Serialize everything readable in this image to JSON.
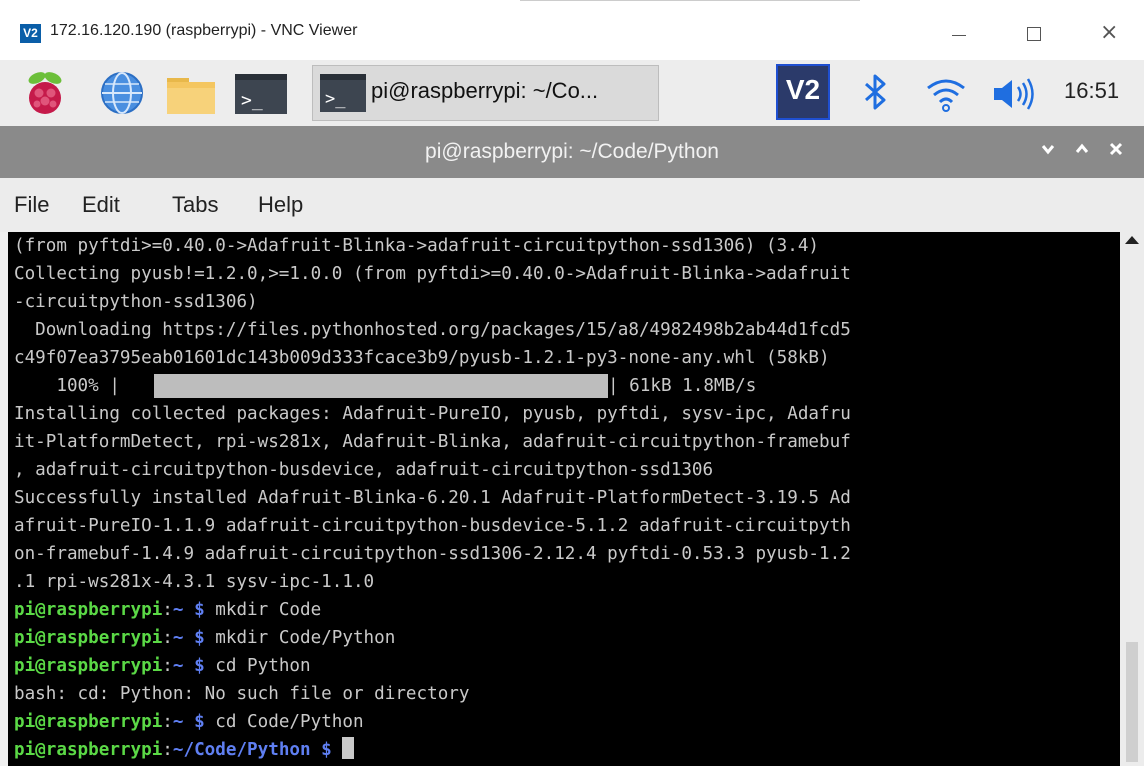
{
  "vnc_window": {
    "logo": "V2",
    "title": "172.16.120.190 (raspberrypi) - VNC Viewer",
    "close_glyph": "×"
  },
  "taskbar": {
    "icons": [
      "raspberry-menu-icon",
      "web-browser-icon",
      "file-manager-icon",
      "terminal-icon"
    ],
    "task_label": "pi@raspberrypi: ~/Co...",
    "vnc_tray_label": "V2",
    "clock": "16:51"
  },
  "terminal_window": {
    "title": "pi@raspberrypi: ~/Code/Python",
    "controls": [
      "v",
      "^",
      "x"
    ]
  },
  "menu": {
    "file": "File",
    "edit": "Edit",
    "tabs": "Tabs",
    "help": "Help"
  },
  "terminal": {
    "output": [
      "(from pyftdi>=0.40.0->Adafruit-Blinka->adafruit-circuitpython-ssd1306) (3.4)",
      "Collecting pyusb!=1.2.0,>=1.0.0 (from pyftdi>=0.40.0->Adafruit-Blinka->adafruit",
      "-circuitpython-ssd1306)",
      "  Downloading https://files.pythonhosted.org/packages/15/a8/4982498b2ab44d1fcd5",
      "c49f07ea3795eab01601dc143b009d333fcace3b9/pyusb-1.2.1-py3-none-any.whl (58kB)"
    ],
    "progress": {
      "percent_label": "    100% |",
      "fraction": 1.0,
      "suffix": "| 61kB 1.8MB/s"
    },
    "output2": [
      "Installing collected packages: Adafruit-PureIO, pyusb, pyftdi, sysv-ipc, Adafru",
      "it-PlatformDetect, rpi-ws281x, Adafruit-Blinka, adafruit-circuitpython-framebuf",
      ", adafruit-circuitpython-busdevice, adafruit-circuitpython-ssd1306",
      "Successfully installed Adafruit-Blinka-6.20.1 Adafruit-PlatformDetect-3.19.5 Ad",
      "afruit-PureIO-1.1.9 adafruit-circuitpython-busdevice-5.1.2 adafruit-circuitpyth",
      "on-framebuf-1.4.9 adafruit-circuitpython-ssd1306-2.12.4 pyftdi-0.53.3 pyusb-1.2",
      ".1 rpi-ws281x-4.3.1 sysv-ipc-1.1.0"
    ],
    "prompt_user": "pi@raspberrypi",
    "prompt_colon": ":",
    "prompt_dollar": " $",
    "commands": [
      {
        "path": "~",
        "cmd": " mkdir Code"
      },
      {
        "path": "~",
        "cmd": " mkdir Code/Python"
      },
      {
        "path": "~",
        "cmd": " cd Python"
      }
    ],
    "error_line": "bash: cd: Python: No such file or directory",
    "commands2": [
      {
        "path": "~",
        "cmd": " cd Code/Python"
      }
    ],
    "current_prompt": {
      "path": "~/Code/Python",
      "cmd": " "
    }
  },
  "colors": {
    "prompt_user": "#5bd946",
    "prompt_path": "#5f7ff2",
    "terminal_bg": "#000000",
    "terminal_text": "#c9c9c9"
  }
}
